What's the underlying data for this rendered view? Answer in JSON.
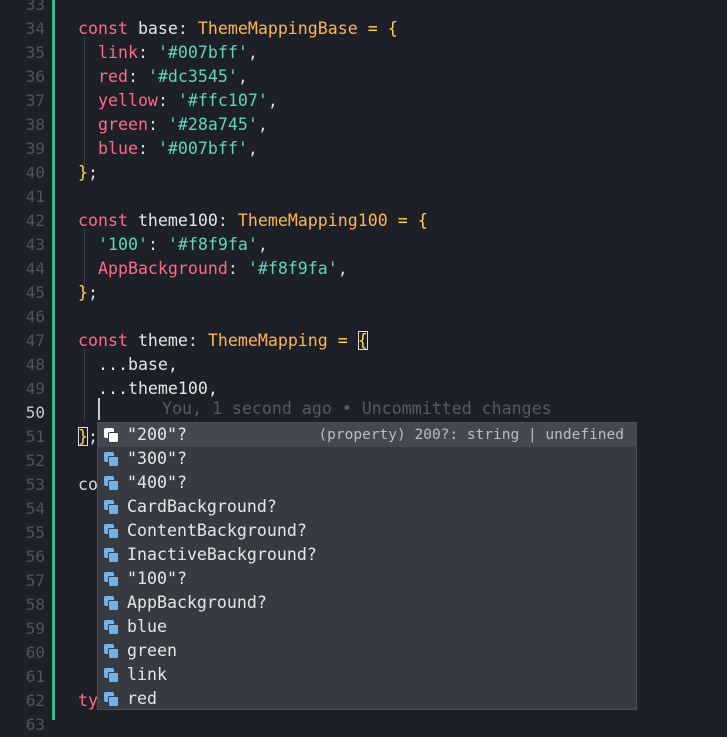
{
  "gutter": {
    "line_numbers": [
      "33",
      "34",
      "35",
      "36",
      "37",
      "38",
      "39",
      "40",
      "41",
      "42",
      "43",
      "44",
      "45",
      "46",
      "47",
      "48",
      "49",
      "50",
      "51",
      "52",
      "53",
      "54",
      "55",
      "56",
      "57",
      "58",
      "59",
      "60",
      "61",
      "62",
      "63"
    ],
    "current_line": "50"
  },
  "code": {
    "l34": {
      "kw": "const",
      "name": " base",
      "colon": ":",
      "type": " ThemeMappingBase",
      "eq": " =",
      "brace": " {"
    },
    "l35": {
      "prop": "link",
      "colon": ": ",
      "str": "'#007bff'",
      "comma": ","
    },
    "l36": {
      "prop": "red",
      "colon": ": ",
      "str": "'#dc3545'",
      "comma": ","
    },
    "l37": {
      "prop": "yellow",
      "colon": ": ",
      "str": "'#ffc107'",
      "comma": ","
    },
    "l38": {
      "prop": "green",
      "colon": ": ",
      "str": "'#28a745'",
      "comma": ","
    },
    "l39": {
      "prop": "blue",
      "colon": ": ",
      "str": "'#007bff'",
      "comma": ","
    },
    "l40": {
      "brace": "}",
      "semi": ";"
    },
    "l42": {
      "kw": "const",
      "name": " theme100",
      "colon": ":",
      "type": " ThemeMapping100",
      "eq": " =",
      "brace": " {"
    },
    "l43": {
      "str1": "'100'",
      "colon": ": ",
      "str": "'#f8f9fa'",
      "comma": ","
    },
    "l44": {
      "prop": "AppBackground",
      "colon": ": ",
      "str": "'#f8f9fa'",
      "comma": ","
    },
    "l45": {
      "brace": "}",
      "semi": ";"
    },
    "l47": {
      "kw": "const",
      "name": " theme",
      "colon": ":",
      "type": " ThemeMapping",
      "eq": " =",
      "brace": "{"
    },
    "l48": {
      "text": "...base,"
    },
    "l49": {
      "text": "...theme100,"
    },
    "l51": {
      "brace": "}",
      "semi": ";"
    },
    "l53": {
      "partial": "co"
    },
    "l62": {
      "partial": "ty"
    }
  },
  "blame": "You, 1 second ago • Uncommitted changes",
  "suggest": {
    "detail": "(property) 200?: string | undefined",
    "items": [
      "\"200\"?",
      "\"300\"?",
      "\"400\"?",
      "CardBackground?",
      "ContentBackground?",
      "InactiveBackground?",
      "\"100\"?",
      "AppBackground?",
      "blue",
      "green",
      "link",
      "red"
    ]
  },
  "colors": {
    "keyword": "#ff6a8a",
    "type": "#ffb454",
    "string": "#5fd4c2",
    "operator": "#ffd84a",
    "gutter_bar": "#3fb68b",
    "icon": "#6db3f2"
  }
}
